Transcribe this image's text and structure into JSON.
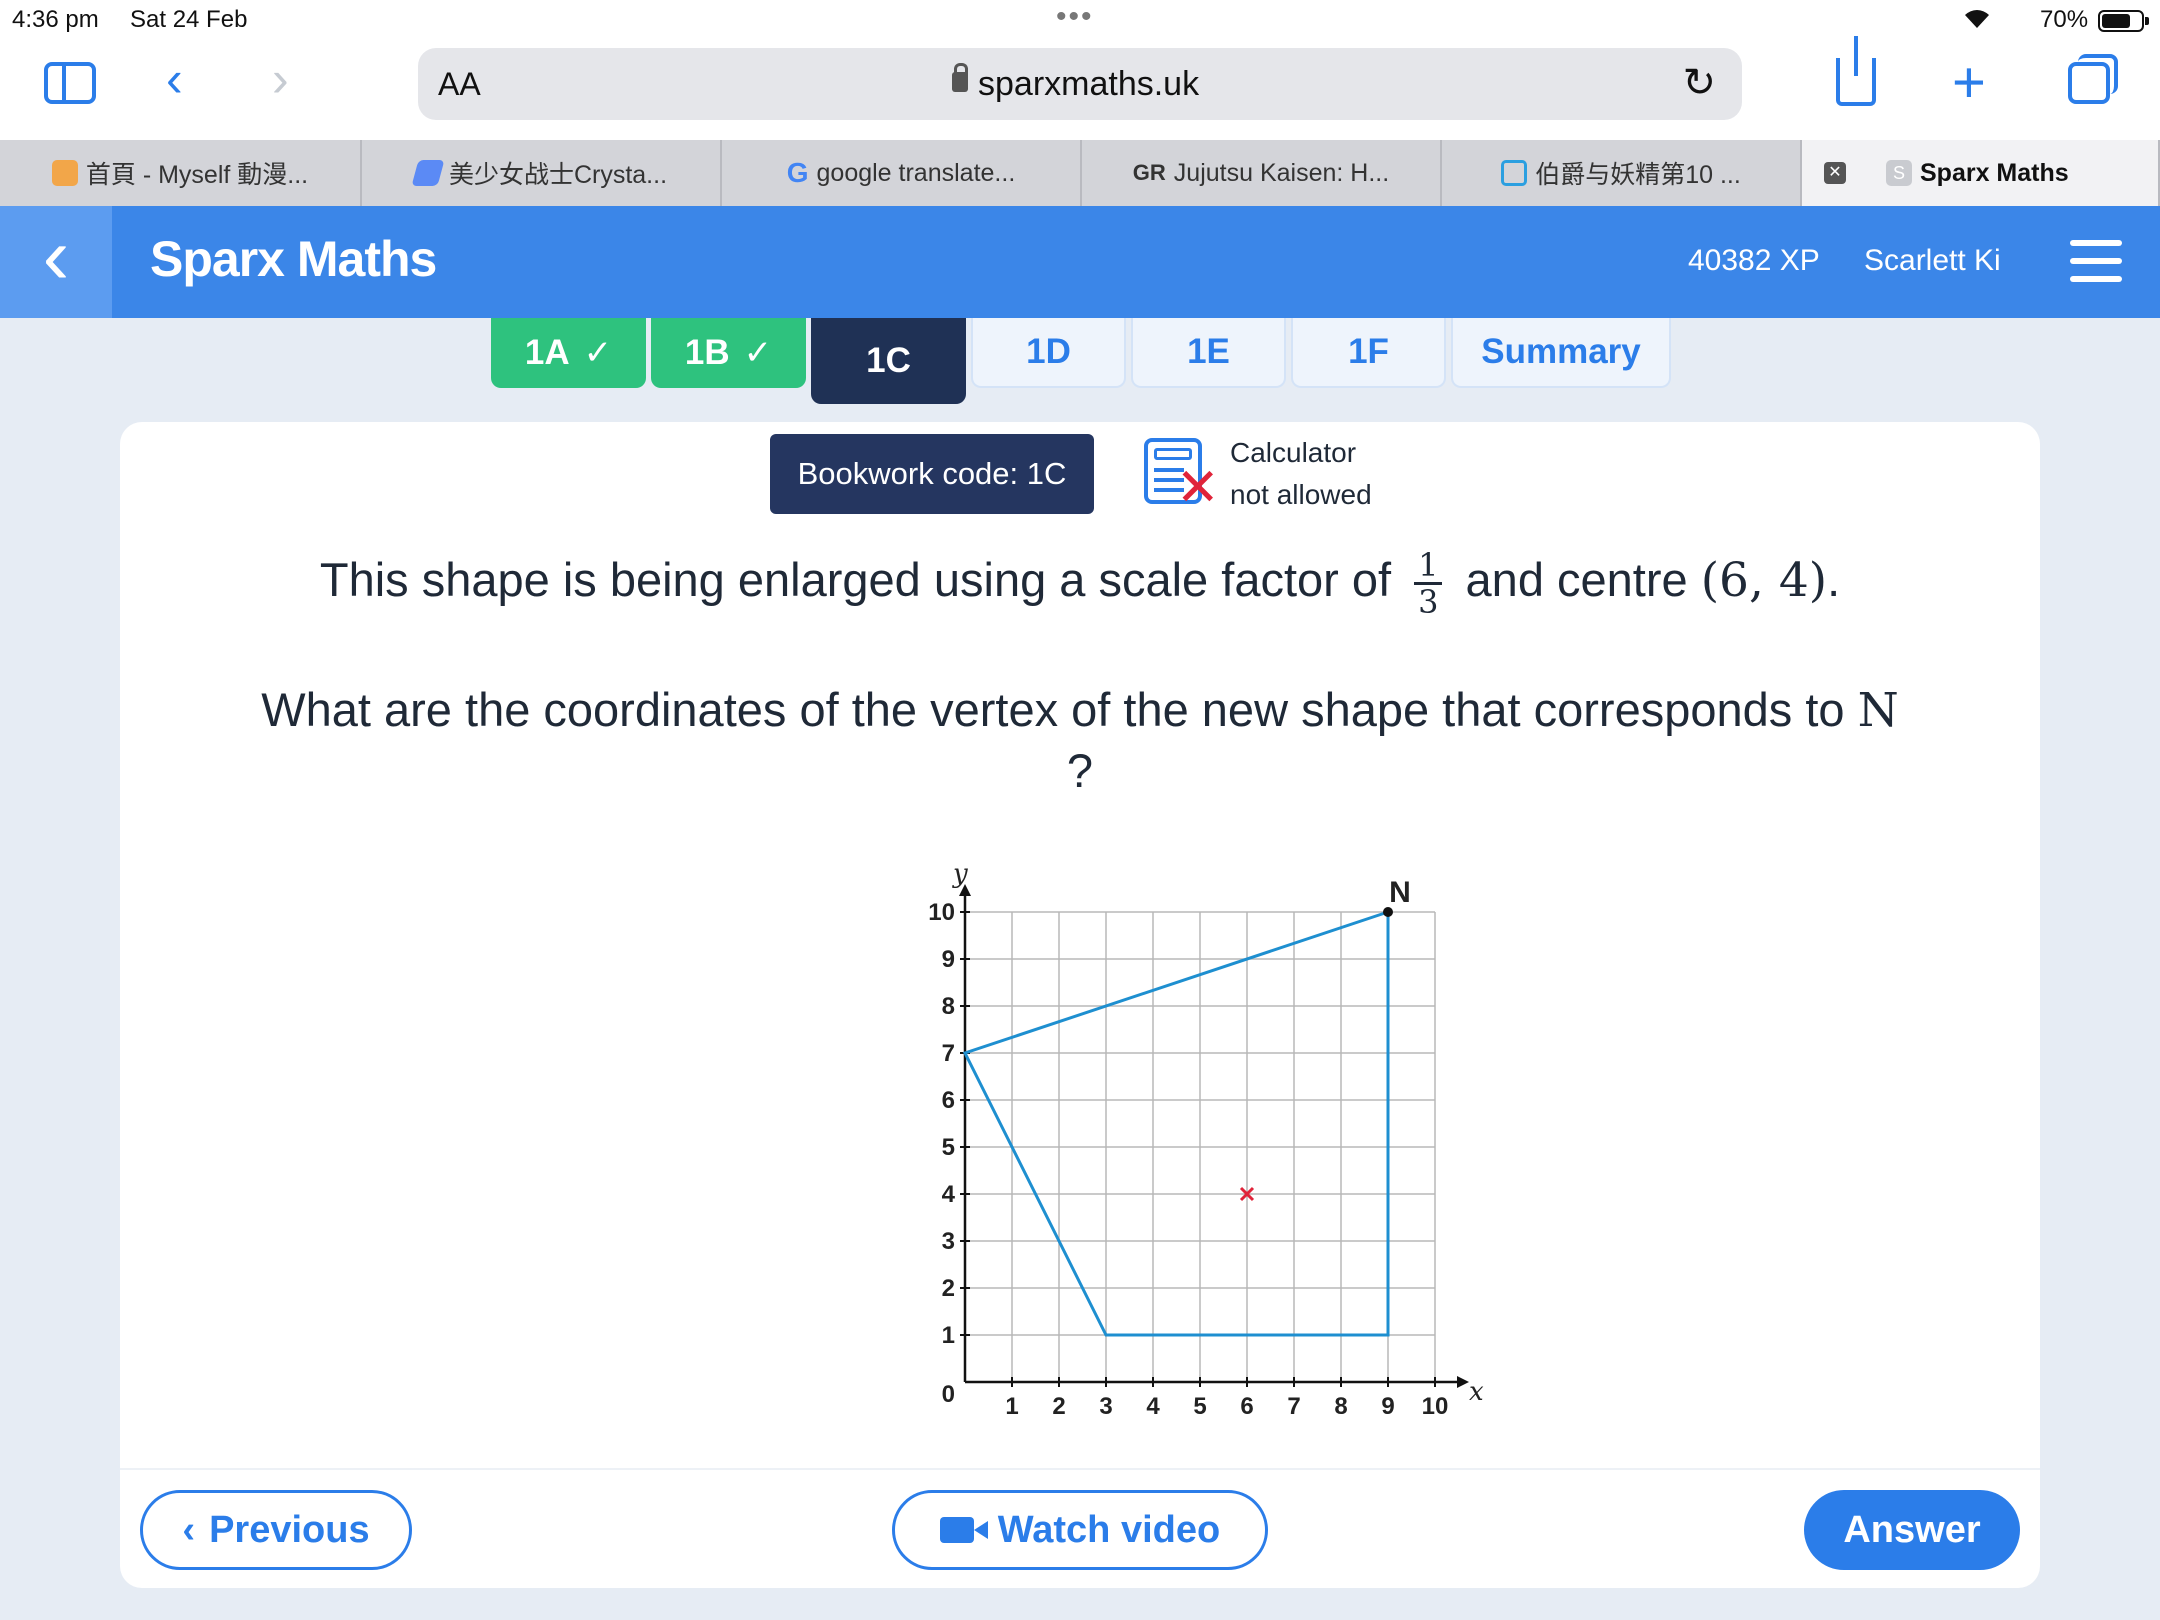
{
  "status_bar": {
    "time": "4:36 pm",
    "date": "Sat 24 Feb",
    "battery": "70%"
  },
  "browser": {
    "aa_label": "AA",
    "url": "sparxmaths.uk",
    "tabs": [
      {
        "label": "首頁 - Myself 動漫...",
        "favicon_color": "#f2a649"
      },
      {
        "label": "美少女战士Crysta...",
        "favicon_color": "#5b8af5"
      },
      {
        "label": "google translate...",
        "favicon_color": "#4285f4"
      },
      {
        "label": "Jujutsu Kaisen: H...",
        "favicon_color": "#f24b2b"
      },
      {
        "label": "伯爵与妖精第10 ...",
        "favicon_color": "#2b9fe0"
      },
      {
        "label": "Sparx Maths",
        "favicon_color": "#c9cbd0",
        "favicon_letter": "S"
      }
    ],
    "google_letter": "G",
    "gr_letters": "GR"
  },
  "app": {
    "brand": "Sparx Maths",
    "xp": "40382 XP",
    "user": "Scarlett Ki"
  },
  "task_tabs": [
    {
      "label": "1A",
      "state": "done"
    },
    {
      "label": "1B",
      "state": "done"
    },
    {
      "label": "1C",
      "state": "current"
    },
    {
      "label": "1D",
      "state": "todo"
    },
    {
      "label": "1E",
      "state": "todo"
    },
    {
      "label": "1F",
      "state": "todo"
    },
    {
      "label": "Summary",
      "state": "todo"
    }
  ],
  "question": {
    "bookwork": "Bookwork code: 1C",
    "calculator_line1": "Calculator",
    "calculator_line2": "not allowed",
    "line1_before": "This shape is being enlarged using a scale factor of",
    "fraction_num": "1",
    "fraction_den": "3",
    "line1_middle": "and centre",
    "centre": "(6, 4)",
    "line1_end": ".",
    "line2": "What are the coordinates of the vertex of the new shape that corresponds to",
    "vertex": "N",
    "line2_end": "?"
  },
  "graph": {
    "x_label": "x",
    "y_label": "y",
    "origin_label": "0",
    "x_ticks": [
      "1",
      "2",
      "3",
      "4",
      "5",
      "6",
      "7",
      "8",
      "9",
      "10"
    ],
    "y_ticks": [
      "1",
      "2",
      "3",
      "4",
      "5",
      "6",
      "7",
      "8",
      "9",
      "10"
    ],
    "x_max": 10,
    "y_max": 10,
    "shape": [
      [
        9,
        10
      ],
      [
        0,
        7
      ],
      [
        3,
        1
      ],
      [
        9,
        1
      ]
    ],
    "vertex_label": "N",
    "vertex_point": [
      9,
      10
    ],
    "centre_point": [
      6,
      4
    ],
    "shape_color": "#1e8fd0",
    "centre_color": "#e0243a"
  },
  "buttons": {
    "previous": "Previous",
    "watch_video": "Watch video",
    "answer": "Answer"
  },
  "colors": {
    "header_blue": "#3b86e8",
    "done_green": "#2ec27e",
    "current_navy": "#1f3155",
    "accent": "#2b7de9"
  }
}
